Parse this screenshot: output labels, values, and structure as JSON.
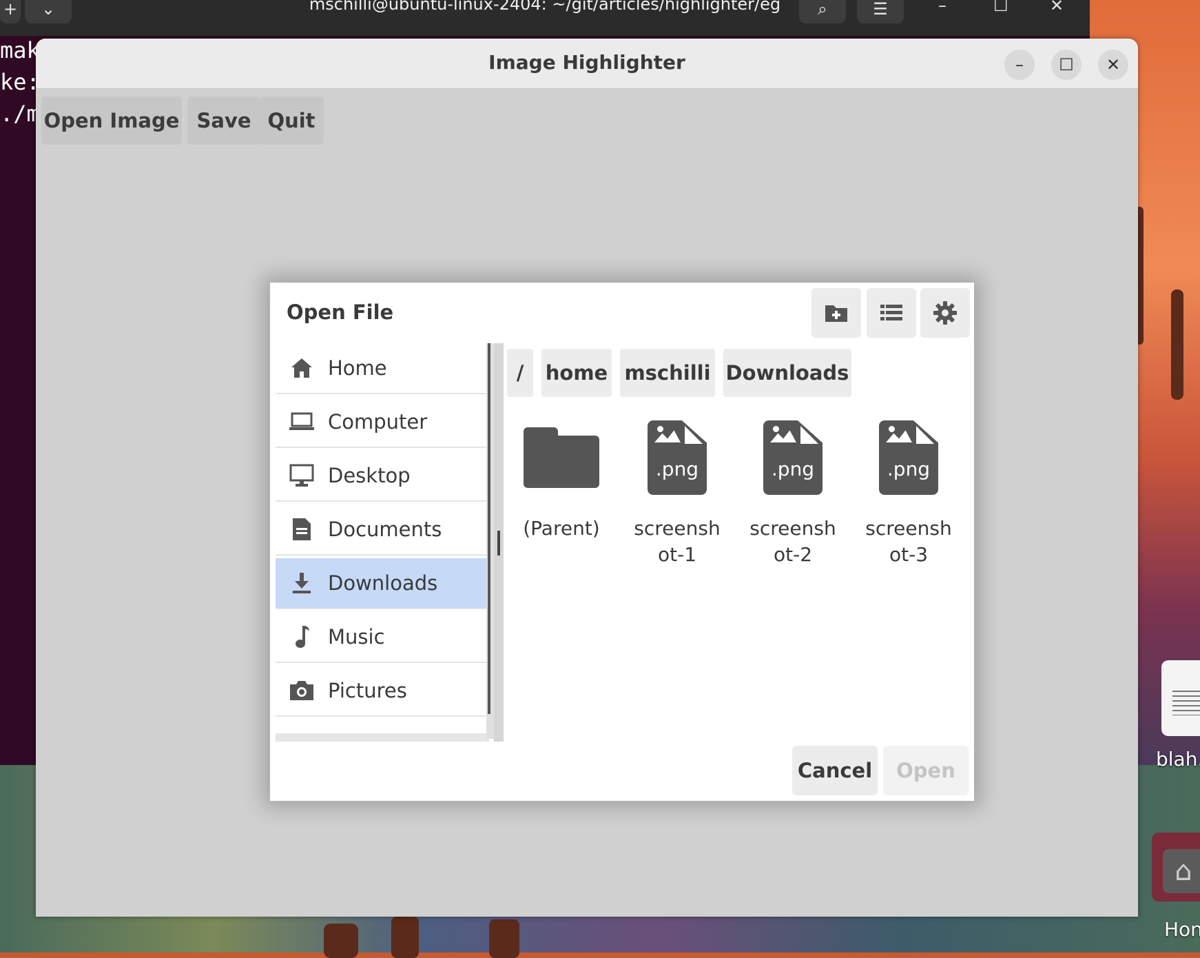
{
  "terminal": {
    "title": "mschilli@ubuntu-linux-2404: ~/git/articles/highlighter/eg",
    "lines": [
      "mak",
      "ke:",
      "./m"
    ]
  },
  "app": {
    "title": "Image Highlighter",
    "toolbar": {
      "open_label": "Open Image",
      "save_label": "Save",
      "quit_label": "Quit"
    }
  },
  "dialog": {
    "title": "Open File",
    "places": [
      {
        "label": "Home",
        "icon": "home-icon"
      },
      {
        "label": "Computer",
        "icon": "laptop-icon"
      },
      {
        "label": "Desktop",
        "icon": "monitor-icon"
      },
      {
        "label": "Documents",
        "icon": "document-icon"
      },
      {
        "label": "Downloads",
        "icon": "download-icon",
        "selected": true
      },
      {
        "label": "Music",
        "icon": "music-note-icon"
      },
      {
        "label": "Pictures",
        "icon": "camera-icon"
      }
    ],
    "breadcrumb": [
      "/",
      "home",
      "mschilli",
      "Downloads"
    ],
    "files": [
      {
        "name": "(Parent)",
        "type": "folder"
      },
      {
        "name": "screensh ot-1",
        "type": "png",
        "ext": ".png"
      },
      {
        "name": "screensh ot-2",
        "type": "png",
        "ext": ".png"
      },
      {
        "name": "screensh ot-3",
        "type": "png",
        "ext": ".png"
      }
    ],
    "cancel_label": "Cancel",
    "open_label": "Open"
  },
  "desktop": {
    "icon1_label": "blah.",
    "icon2_label": "Hon"
  },
  "colors": {
    "selection": "#c6d9f7",
    "terminal_bg": "#300a24",
    "disabled_text": "#c4c4c4"
  }
}
